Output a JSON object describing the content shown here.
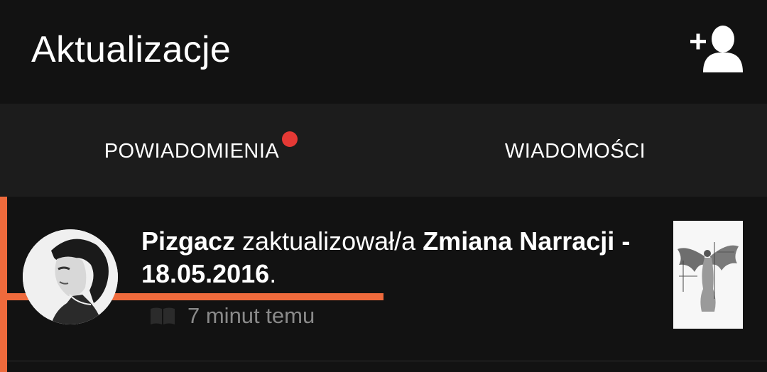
{
  "appbar": {
    "title": "Aktualizacje",
    "action_icon": "add-user-icon"
  },
  "tabs": [
    {
      "label": "POWIADOMIENIA",
      "selected": true,
      "has_badge_dot": true
    },
    {
      "label": "WIADOMOŚCI",
      "selected": false,
      "has_badge_dot": false
    }
  ],
  "colors": {
    "accent": "#ee6a3c",
    "badge": "#e53935",
    "background": "#121212",
    "tabbar": "#1c1c1c",
    "muted_text": "#8a8a8a"
  },
  "notifications": [
    {
      "user": "Pizgacz",
      "action": " zaktualizował/a ",
      "story": "Zmiana Narracji - 18.05.2016",
      "end": ".",
      "time": "7 minut temu",
      "type_icon": "book-icon",
      "unread": true
    }
  ]
}
